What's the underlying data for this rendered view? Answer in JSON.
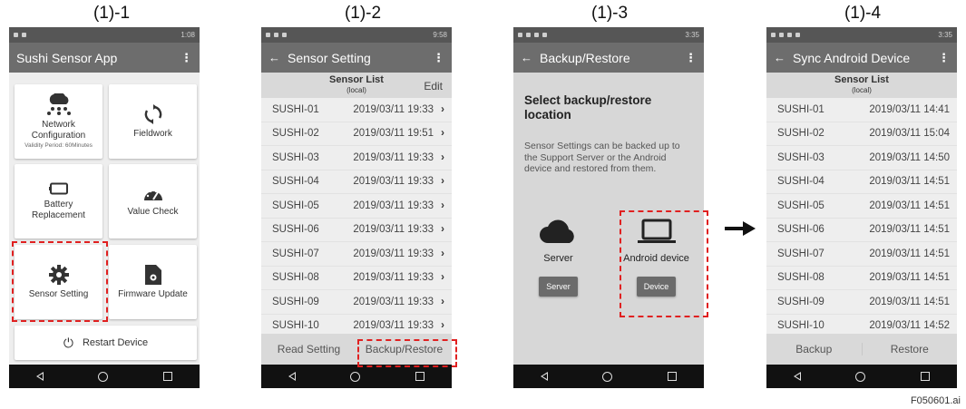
{
  "captions": [
    "(1)-1",
    "(1)-2",
    "(1)-3",
    "(1)-4"
  ],
  "figure_id": "F050601.ai",
  "highlight_color": "#e02020",
  "screen1": {
    "time": "1:08",
    "title": "Sushi Sensor App",
    "tiles": {
      "network_label": "Network Configuration",
      "network_sub": "Validity Period: 60Minutes",
      "fieldwork_label": "Fieldwork",
      "battery_label": "Battery Replacement",
      "value_check_label": "Value Check",
      "sensor_setting_label": "Sensor Setting",
      "firmware_label": "Firmware Update"
    },
    "restart_label": "Restart Device"
  },
  "screen2": {
    "time": "9:58",
    "title": "Sensor Setting",
    "list_title": "Sensor List",
    "list_sub": "(local)",
    "edit_label": "Edit",
    "rows": [
      {
        "name": "SUSHI-01",
        "date": "2019/03/11  19:33"
      },
      {
        "name": "SUSHI-02",
        "date": "2019/03/11  19:51"
      },
      {
        "name": "SUSHI-03",
        "date": "2019/03/11  19:33"
      },
      {
        "name": "SUSHI-04",
        "date": "2019/03/11  19:33"
      },
      {
        "name": "SUSHI-05",
        "date": "2019/03/11  19:33"
      },
      {
        "name": "SUSHI-06",
        "date": "2019/03/11  19:33"
      },
      {
        "name": "SUSHI-07",
        "date": "2019/03/11  19:33"
      },
      {
        "name": "SUSHI-08",
        "date": "2019/03/11  19:33"
      },
      {
        "name": "SUSHI-09",
        "date": "2019/03/11  19:33"
      },
      {
        "name": "SUSHI-10",
        "date": "2019/03/11  19:33"
      }
    ],
    "read_setting_label": "Read Setting",
    "backup_restore_label": "Backup/Restore"
  },
  "screen3": {
    "time": "3:35",
    "title": "Backup/Restore",
    "heading": "Select backup/restore location",
    "description": "Sensor Settings can be backed up to the Support Server or the Android device and restored from them.",
    "server_label": "Server",
    "server_button": "Server",
    "device_label": "Android device",
    "device_button": "Device"
  },
  "screen4": {
    "time": "3:35",
    "title": "Sync Android Device",
    "list_title": "Sensor List",
    "list_sub": "(local)",
    "rows": [
      {
        "name": "SUSHI-01",
        "date": "2019/03/11  14:41"
      },
      {
        "name": "SUSHI-02",
        "date": "2019/03/11  15:04"
      },
      {
        "name": "SUSHI-03",
        "date": "2019/03/11  14:50"
      },
      {
        "name": "SUSHI-04",
        "date": "2019/03/11  14:51"
      },
      {
        "name": "SUSHI-05",
        "date": "2019/03/11  14:51"
      },
      {
        "name": "SUSHI-06",
        "date": "2019/03/11  14:51"
      },
      {
        "name": "SUSHI-07",
        "date": "2019/03/11  14:51"
      },
      {
        "name": "SUSHI-08",
        "date": "2019/03/11  14:51"
      },
      {
        "name": "SUSHI-09",
        "date": "2019/03/11  14:51"
      },
      {
        "name": "SUSHI-10",
        "date": "2019/03/11  14:52"
      }
    ],
    "backup_label": "Backup",
    "restore_label": "Restore"
  }
}
